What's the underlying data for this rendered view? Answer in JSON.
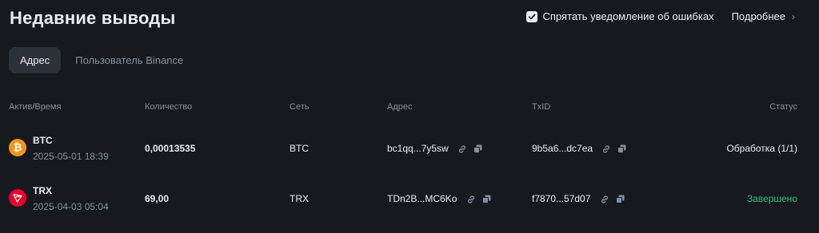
{
  "page": {
    "title": "Недавние выводы",
    "hide_errors_label": "Спрятать уведомление об ошибках",
    "hide_errors_checked": true,
    "more_label": "Подробнее"
  },
  "tabs": [
    {
      "label": "Адрес",
      "active": true
    },
    {
      "label": "Пользователь Binance",
      "active": false
    }
  ],
  "table": {
    "headers": {
      "asset": "Актив/Время",
      "amount": "Количество",
      "network": "Сеть",
      "address": "Адрес",
      "txid": "TxID",
      "status": "Статус"
    },
    "rows": [
      {
        "asset": "BTC",
        "time": "2025-05-01 18:39",
        "amount": "0,00013535",
        "network": "BTC",
        "address": "bc1qq...7y5sw",
        "txid": "9b5a6...dc7ea",
        "status": "Обработка (1/1)",
        "coin_color": "#f7931a",
        "coin_icon": "bitcoin-icon"
      },
      {
        "asset": "TRX",
        "time": "2025-04-03 05:04",
        "amount": "69,00",
        "network": "TRX",
        "address": "TDn2B...MC6Ko",
        "txid": "f7870...57d07",
        "status": "Завершено",
        "status_color": "#2ebd85",
        "coin_color": "#eb0029",
        "coin_icon": "tron-icon"
      }
    ]
  },
  "colors": {
    "background": "#161a1e",
    "accent_green": "#2ebd85",
    "muted_text": "#848e9c"
  }
}
